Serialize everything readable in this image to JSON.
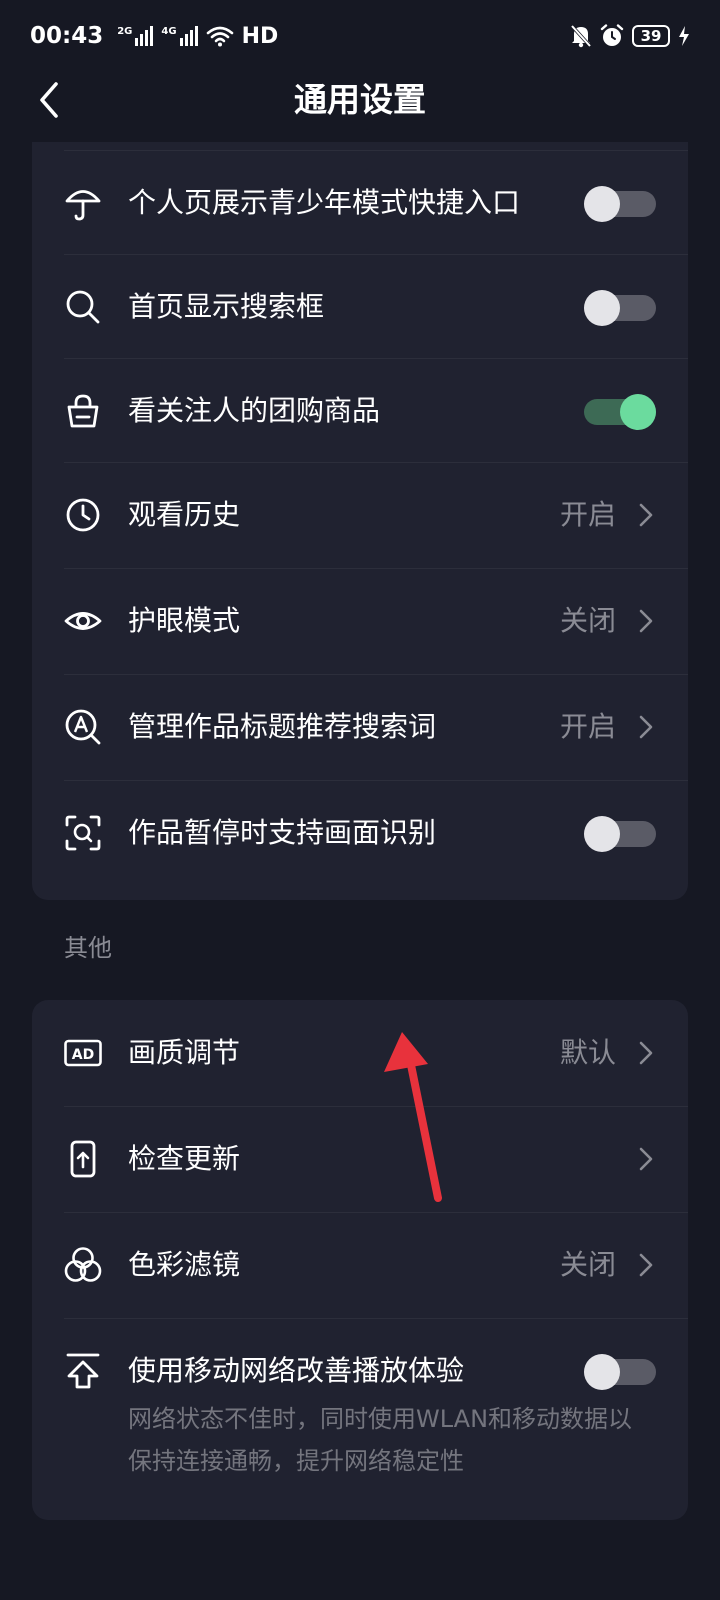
{
  "status_bar": {
    "time": "00:43",
    "network1": "2G",
    "network2": "4G",
    "hd": "HD",
    "battery": "39"
  },
  "header": {
    "title": "通用设置"
  },
  "group1": {
    "rows": [
      {
        "icon": "umbrella-icon",
        "label": "个人页展示青少年模式快捷入口",
        "type": "toggle",
        "on": false
      },
      {
        "icon": "search-icon",
        "label": "首页显示搜索框",
        "type": "toggle",
        "on": false
      },
      {
        "icon": "shopping-bag-icon",
        "label": "看关注人的团购商品",
        "type": "toggle",
        "on": true
      },
      {
        "icon": "clock-icon",
        "label": "观看历史",
        "type": "link",
        "value": "开启"
      },
      {
        "icon": "eye-icon",
        "label": "护眼模式",
        "type": "link",
        "value": "关闭"
      },
      {
        "icon": "search-text-icon",
        "label": "管理作品标题推荐搜索词",
        "type": "link",
        "value": "开启"
      },
      {
        "icon": "scan-icon",
        "label": "作品暂停时支持画面识别",
        "type": "toggle",
        "on": false
      }
    ]
  },
  "section_other": {
    "title": "其他"
  },
  "group2": {
    "rows": [
      {
        "icon": "ad-icon",
        "label": "画质调节",
        "type": "link",
        "value": "默认"
      },
      {
        "icon": "phone-update-icon",
        "label": "检查更新",
        "type": "link",
        "value": ""
      },
      {
        "icon": "color-filter-icon",
        "label": "色彩滤镜",
        "type": "link",
        "value": "关闭"
      },
      {
        "icon": "upload-arrow-icon",
        "label": "使用移动网络改善播放体验",
        "type": "toggle",
        "on": false,
        "description": "网络状态不佳时，同时使用WLAN和移动数据以保持连接通畅，提升网络稳定性"
      }
    ]
  },
  "colors": {
    "background": "#161823",
    "card": "#202230",
    "toggle_on": "#6bdb9e",
    "annotation_arrow": "#e8323c"
  }
}
